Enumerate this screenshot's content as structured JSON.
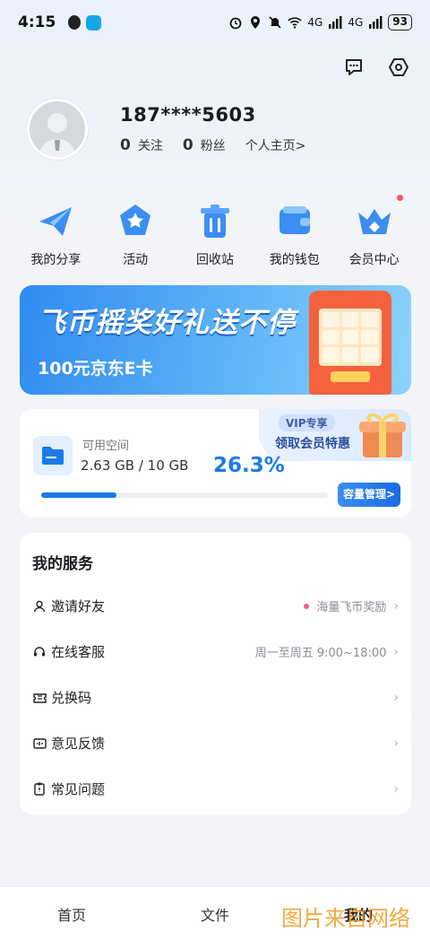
{
  "status_bar": {
    "time": "4:15",
    "battery": "93",
    "network_1": "4G",
    "network_2": "4G",
    "wifi_badge": "6"
  },
  "top_actions": {
    "message_icon": "message-icon",
    "settings_icon": "settings-icon"
  },
  "profile": {
    "phone": "187****5603",
    "follow_count": "0",
    "follow_label": "关注",
    "fans_count": "0",
    "fans_label": "粉丝",
    "home_link": "个人主页>"
  },
  "quick_nav": [
    {
      "label": "我的分享",
      "icon": "paper-plane-icon"
    },
    {
      "label": "活动",
      "icon": "star-badge-icon"
    },
    {
      "label": "回收站",
      "icon": "trash-icon"
    },
    {
      "label": "我的钱包",
      "icon": "wallet-icon"
    },
    {
      "label": "会员中心",
      "icon": "crown-icon"
    }
  ],
  "banner": {
    "title": "飞币摇奖好礼送不停",
    "subtitle": "100元京东E卡"
  },
  "storage": {
    "label": "可用空间",
    "used": "2.63 GB / 10 GB",
    "percent_text": "26.3%",
    "percent": 0.263,
    "manage_button": "容量管理>",
    "vip_badge": "VIP专享",
    "vip_link": "领取会员特惠"
  },
  "services": {
    "title": "我的服务",
    "items": [
      {
        "label": "邀请好友",
        "right": "海量飞币奖励",
        "icon": "person-icon",
        "dot": true
      },
      {
        "label": "在线客服",
        "right": "周一至周五 9:00~18:00",
        "icon": "headset-icon",
        "dot": false
      },
      {
        "label": "兑换码",
        "right": "",
        "icon": "ticket-icon",
        "dot": false
      },
      {
        "label": "意见反馈",
        "right": "",
        "icon": "feedback-icon",
        "dot": false
      },
      {
        "label": "常见问题",
        "right": "",
        "icon": "faq-icon",
        "dot": false
      }
    ]
  },
  "tabbar": {
    "tabs": [
      "首页",
      "文件",
      "我的"
    ],
    "active": 2
  },
  "watermark": "图片来自网络",
  "colors": {
    "accent": "#1a7ae8",
    "banner": "#2f8bf0",
    "dot": "#ef5d7e"
  }
}
